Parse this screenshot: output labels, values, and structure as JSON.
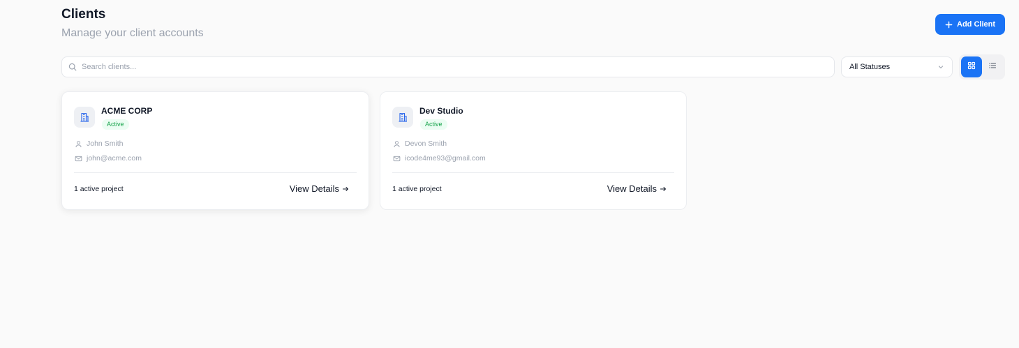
{
  "header": {
    "title": "Clients",
    "subtitle": "Manage your client accounts",
    "add_button_label": "Add Client"
  },
  "toolbar": {
    "search_placeholder": "Search clients...",
    "status_filter": "All Statuses",
    "view_mode": "grid"
  },
  "colors": {
    "accent": "#1a73f5",
    "status_active_bg": "#ecfdf3",
    "status_active_text": "#16a34a"
  },
  "clients": [
    {
      "name": "ACME CORP",
      "status": "Active",
      "contact": "John Smith",
      "email": "john@acme.com",
      "projects": "1 active project",
      "details_label": "View Details"
    },
    {
      "name": "Dev Studio",
      "status": "Active",
      "contact": "Devon Smith",
      "email": "icode4me93@gmail.com",
      "projects": "1 active project",
      "details_label": "View Details"
    }
  ]
}
